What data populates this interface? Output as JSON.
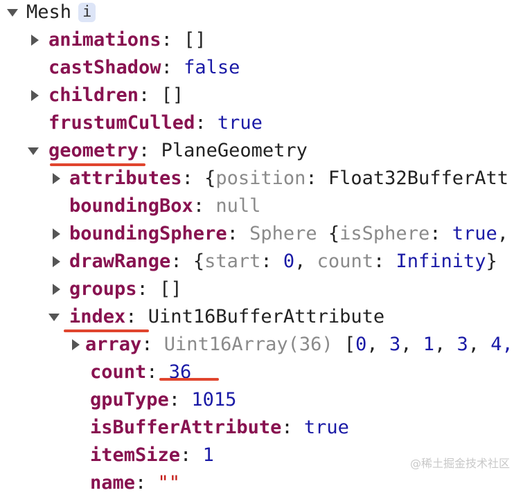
{
  "root": {
    "label": "Mesh",
    "badge": "i"
  },
  "rows": {
    "animations": {
      "key": "animations",
      "value": "[]"
    },
    "castShadow": {
      "key": "castShadow",
      "value": "false"
    },
    "children": {
      "key": "children",
      "value": "[]"
    },
    "frustumCulled": {
      "key": "frustumCulled",
      "value": "true"
    },
    "geometry": {
      "key": "geometry",
      "value": "PlaneGeometry"
    },
    "attributes": {
      "key": "attributes",
      "v1": "{",
      "v2": "position",
      "v3": ": Float32BufferAtt"
    },
    "boundingBox": {
      "key": "boundingBox",
      "value": "null"
    },
    "boundingSphere": {
      "key": "boundingSphere",
      "v1": "Sphere ",
      "v2": "{",
      "v3": "isSphere",
      "v4": ": ",
      "v5": "true",
      "v6": ","
    },
    "drawRange": {
      "key": "drawRange",
      "v1": "{",
      "v2": "start",
      "v3": ": ",
      "v4": "0",
      "v5": ", ",
      "v6": "count",
      "v7": ": ",
      "v8": "Infinity",
      "v9": "}"
    },
    "groups": {
      "key": "groups",
      "value": "[]"
    },
    "index": {
      "key": "index",
      "value": "Uint16BufferAttribute"
    },
    "array": {
      "key": "array",
      "v1": "Uint16Array(36) ",
      "v2": "[",
      "v3": "0",
      "v4": "3",
      "v5": "1",
      "v6": "3",
      "v7": "4,"
    },
    "count": {
      "key": "count",
      "value": "36"
    },
    "gpuType": {
      "key": "gpuType",
      "value": "1015"
    },
    "isBufferAttribute": {
      "key": "isBufferAttribute",
      "value": "true"
    },
    "itemSize": {
      "key": "itemSize",
      "value": "1"
    },
    "name": {
      "key": "name",
      "value": "\"\""
    }
  },
  "watermark": "@稀土掘金技术社区",
  "colors": {
    "key": "#881250",
    "value": "#1a1aa6",
    "annotation": "#e0452e"
  }
}
